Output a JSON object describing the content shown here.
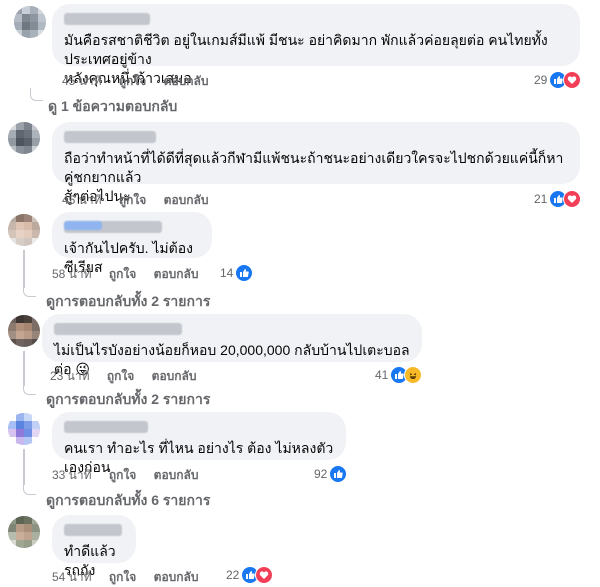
{
  "comments": [
    {
      "text_lines": [
        "มันคือรสชาติชีวิต อยู่ในเกมส์มีแพ้ มีชนะ อย่าคิดมาก พักแล้วค่อยลุยต่อ คนไทยทั้งประเทศอยู่ข้าง",
        "หลังคุณหนึ่งก้าวเสมอ"
      ],
      "time": "45 นาที",
      "like_label": "ถูกใจ",
      "reply_label": "ตอบกลับ",
      "reaction_count": "29",
      "reactions": [
        "like",
        "love"
      ],
      "view_replies": "ดู 1 ข้อความตอบกลับ"
    },
    {
      "text_lines": [
        "ถือว่าทำหน้าที่ได้ดีที่สุดแล้วกีฬามีแพ้ชนะถ้าชนะอย่างเดียวใครจะไปชกด้วยแค่นี้ก็หาคู่ชกยากแล้ว",
        "สู้ๆต่อไปนะ"
      ],
      "time": "45 นาที",
      "like_label": "ถูกใจ",
      "reply_label": "ตอบกลับ",
      "reaction_count": "21",
      "reactions": [
        "like",
        "love"
      ]
    },
    {
      "text_lines": [
        "เจ้ากันไปครับ. ไม่ต้องซีเรียส"
      ],
      "time": "58 นาที",
      "like_label": "ถูกใจ",
      "reply_label": "ตอบกลับ",
      "reaction_count": "14",
      "reactions": [
        "like"
      ],
      "view_replies": "ดูการตอบกลับทั้ง 2 รายการ"
    },
    {
      "text_lines": [
        "ไม่เป็นไรบังอย่างน้อยก็หอบ 20,000,000 กลับบ้านไปเตะบอลต่อ 😜"
      ],
      "time": "23 นาที",
      "like_label": "ถูกใจ",
      "reply_label": "ตอบกลับ",
      "reaction_count": "41",
      "reactions": [
        "like",
        "haha"
      ],
      "view_replies": "ดูการตอบกลับทั้ง 2 รายการ"
    },
    {
      "text_lines": [
        "คนเรา ทำอะไร ที่ไหน อย่างไร ต้อง ไม่หลงตัวเองก่อน"
      ],
      "time": "33 นาที",
      "like_label": "ถูกใจ",
      "reply_label": "ตอบกลับ",
      "reaction_count": "92",
      "reactions": [
        "like"
      ],
      "view_replies": "ดูการตอบกลับทั้ง 6 รายการ"
    },
    {
      "text_lines": [
        "ทำดีแล้วรถถัง"
      ],
      "time": "54 นาที",
      "like_label": "ถูกใจ",
      "reply_label": "ตอบกลับ",
      "reaction_count": "22",
      "reactions": [
        "like",
        "love"
      ]
    }
  ],
  "colors": {
    "like": "#1877f2",
    "love": "#f33e58",
    "haha": "#f7b928",
    "bubble": "#f0f2f5",
    "meta": "#65676b"
  }
}
